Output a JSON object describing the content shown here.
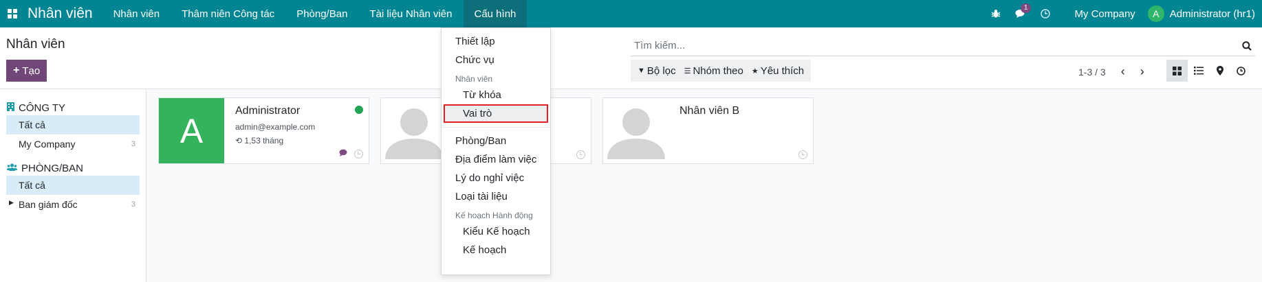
{
  "navbar": {
    "brand": "Nhân viên",
    "menu": [
      {
        "label": "Nhân viên"
      },
      {
        "label": "Thâm niên Công tác"
      },
      {
        "label": "Phòng/Ban"
      },
      {
        "label": "Tài liệu Nhân viên"
      },
      {
        "label": "Cấu hình"
      }
    ],
    "message_count": "1",
    "company": "My Company",
    "user_initial": "A",
    "user_name": "Administrator (hr1)"
  },
  "control": {
    "title": "Nhân viên",
    "create_label": "Tạo",
    "search_placeholder": "Tìm kiếm...",
    "filters_label": "Bộ lọc",
    "group_by_label": "Nhóm theo",
    "favorites_label": "Yêu thích",
    "pager": "1-3 / 3"
  },
  "sidebar": {
    "company_section": "CÔNG TY",
    "company_items": [
      {
        "label": "Tất cả",
        "count": ""
      },
      {
        "label": "My Company",
        "count": "3"
      }
    ],
    "dept_section": "PHÒNG/BAN",
    "dept_items": [
      {
        "label": "Tất cả",
        "count": ""
      },
      {
        "label": "Ban giám đốc",
        "count": "3"
      }
    ]
  },
  "cards": [
    {
      "initial": "A",
      "name": "Administrator",
      "email": "admin@example.com",
      "tenure": "1,53 tháng"
    },
    {
      "name": ""
    },
    {
      "name": "Nhân viên B"
    }
  ],
  "dropdown": {
    "item_settings": "Thiết lập",
    "item_job_position": "Chức vụ",
    "header_employee": "Nhân viên",
    "item_tags": "Từ khóa",
    "item_roles": "Vai trò",
    "item_departments": "Phòng/Ban",
    "item_work_locations": "Địa điểm làm việc",
    "item_departure_reasons": "Lý do nghỉ việc",
    "item_document_types": "Loại tài liệu",
    "header_plans": "Kế hoạch Hành động",
    "item_plan_types": "Kiểu Kế hoạch",
    "item_plans": "Kế hoạch"
  },
  "colors": {
    "navbar": "#018592",
    "primary_button": "#71477a",
    "selected_filter": "#d7ecf6",
    "avatar_green": "#34b25c",
    "highlight_outline": "#e32025"
  }
}
